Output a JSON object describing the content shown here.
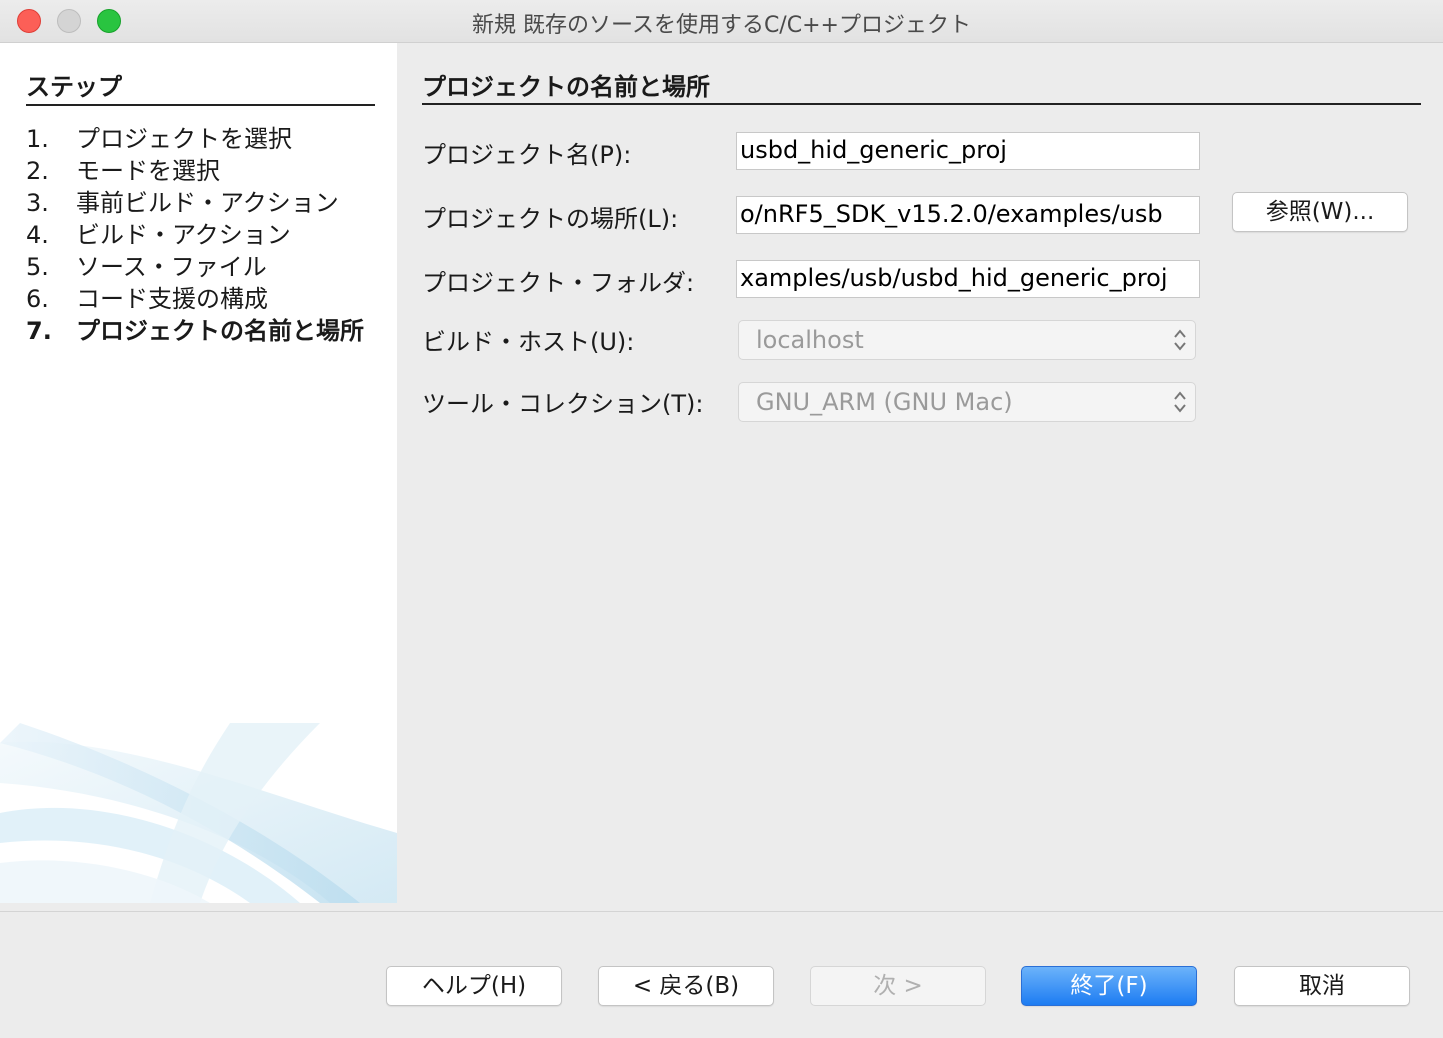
{
  "window": {
    "title": "新規 既存のソースを使用するC/C++プロジェクト"
  },
  "steps": {
    "heading": "ステップ",
    "items": [
      {
        "num": "1.",
        "label": "プロジェクトを選択"
      },
      {
        "num": "2.",
        "label": "モードを選択"
      },
      {
        "num": "3.",
        "label": "事前ビルド・アクション"
      },
      {
        "num": "4.",
        "label": "ビルド・アクション"
      },
      {
        "num": "5.",
        "label": "ソース・ファイル"
      },
      {
        "num": "6.",
        "label": "コード支援の構成"
      },
      {
        "num": "7.",
        "label": "プロジェクトの名前と場所",
        "current": true
      }
    ]
  },
  "form": {
    "heading": "プロジェクトの名前と場所",
    "project_name": {
      "label": "プロジェクト名(P):",
      "value": "usbd_hid_generic_proj"
    },
    "project_location": {
      "label": "プロジェクトの場所(L):",
      "value": "o/nRF5_SDK_v15.2.0/examples/usb"
    },
    "project_folder": {
      "label": "プロジェクト・フォルダ:",
      "value": "xamples/usb/usbd_hid_generic_proj"
    },
    "build_host": {
      "label": "ビルド・ホスト(U):",
      "value": "localhost"
    },
    "tool_collection": {
      "label": "ツール・コレクション(T):",
      "value": "GNU_ARM (GNU Mac)"
    },
    "browse_label": "参照(W)..."
  },
  "buttons": {
    "help": "ヘルプ(H)",
    "back": "< 戻る(B)",
    "next": "次 >",
    "finish": "終了(F)",
    "cancel": "取消"
  },
  "colors": {
    "primary_button": "#1d7cf2",
    "close": "#fc5f57",
    "minimize": "#d4d4d4",
    "maximize": "#29c440"
  }
}
